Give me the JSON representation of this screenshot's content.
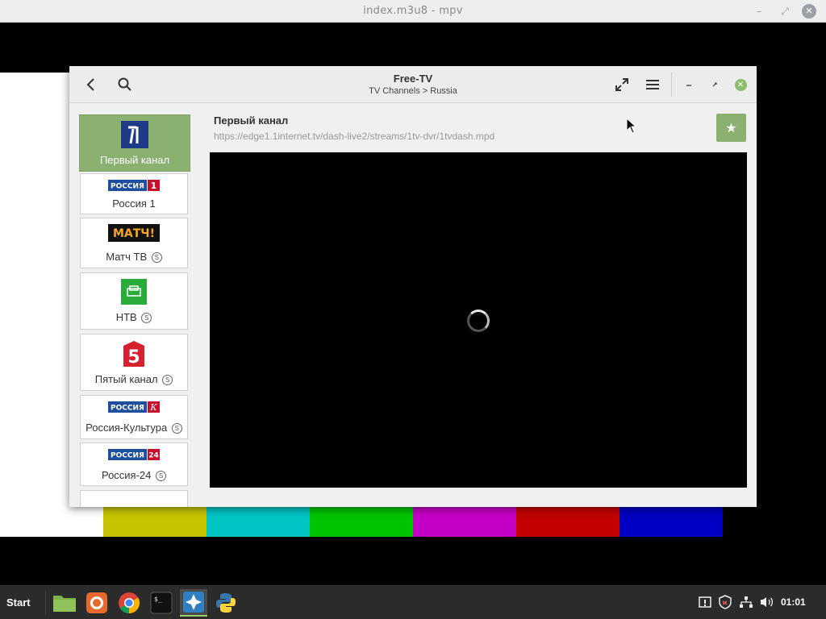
{
  "mpv": {
    "title": "index.m3u8 - mpv"
  },
  "test_pattern": {
    "bar_colors": [
      "#c7c300",
      "#00c4c4",
      "#00c400",
      "#c400c4",
      "#c40000",
      "#0000c4"
    ]
  },
  "app": {
    "title": "Free-TV",
    "subtitle": "TV Channels > Russia",
    "accent_color": "#8bb171",
    "header_icons": [
      "back-icon",
      "search-icon",
      "fullscreen-icon",
      "menu-icon",
      "minimize-icon",
      "restore-icon",
      "close-icon"
    ]
  },
  "sidebar": {
    "channels": [
      {
        "label": "Первый канал",
        "logo_text": "1",
        "active": true,
        "badge": ""
      },
      {
        "label": "Россия 1",
        "logo_text": "РОССИЯ",
        "logo_num": "1",
        "active": false,
        "badge": ""
      },
      {
        "label": "Матч ТВ",
        "logo_text": "МАТЧ!",
        "active": false,
        "badge": "S"
      },
      {
        "label": "НТВ",
        "logo_text": "НТВ",
        "active": false,
        "badge": "S"
      },
      {
        "label": "Пятый канал",
        "logo_text": "5",
        "active": false,
        "badge": "S"
      },
      {
        "label": "Россия-Культура",
        "logo_text": "РОССИЯ",
        "logo_num": "К",
        "active": false,
        "badge": "S"
      },
      {
        "label": "Россия-24",
        "logo_text": "РОССИЯ",
        "logo_num": "24",
        "active": false,
        "badge": "S"
      }
    ]
  },
  "main": {
    "channel_title": "Первый канал",
    "stream_url": "https://edge1.1internet.tv/dash-live2/streams/1tv-dvr/1tvdash.mpd",
    "favorite_icon": "star-icon",
    "player_state": "loading"
  },
  "taskbar": {
    "start_label": "Start",
    "apps": [
      "files-icon",
      "firefox-icon",
      "chrome-icon",
      "terminal-icon",
      "free-tv-icon",
      "python-icon"
    ],
    "tray": [
      "notification-icon",
      "shield-icon",
      "network-icon",
      "volume-icon"
    ],
    "clock": "01:01"
  }
}
